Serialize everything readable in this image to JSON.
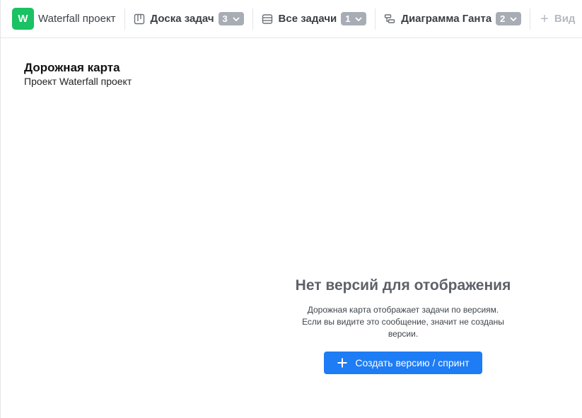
{
  "topbar": {
    "project": {
      "logo_letter": "W",
      "name": "Waterfall проект",
      "logo_color": "#19c262"
    },
    "tabs": [
      {
        "label": "Доска задач",
        "count": "3",
        "icon": "board-icon"
      },
      {
        "label": "Все задачи",
        "count": "1",
        "icon": "list-icon"
      },
      {
        "label": "Диаграмма Ганта",
        "count": "2",
        "icon": "gantt-icon"
      }
    ],
    "add_view_label": "Вид"
  },
  "page": {
    "title": "Дорожная карта",
    "subtitle": "Проект Waterfall проект"
  },
  "empty_state": {
    "title": "Нет версий для отображения",
    "line1": "Дорожная карта отображает задачи по версиям.",
    "line2": "Если вы видите это сообщение, значит не созданы версии.",
    "button_label": "Создать версию / спринт",
    "button_color": "#1e7cf5"
  }
}
